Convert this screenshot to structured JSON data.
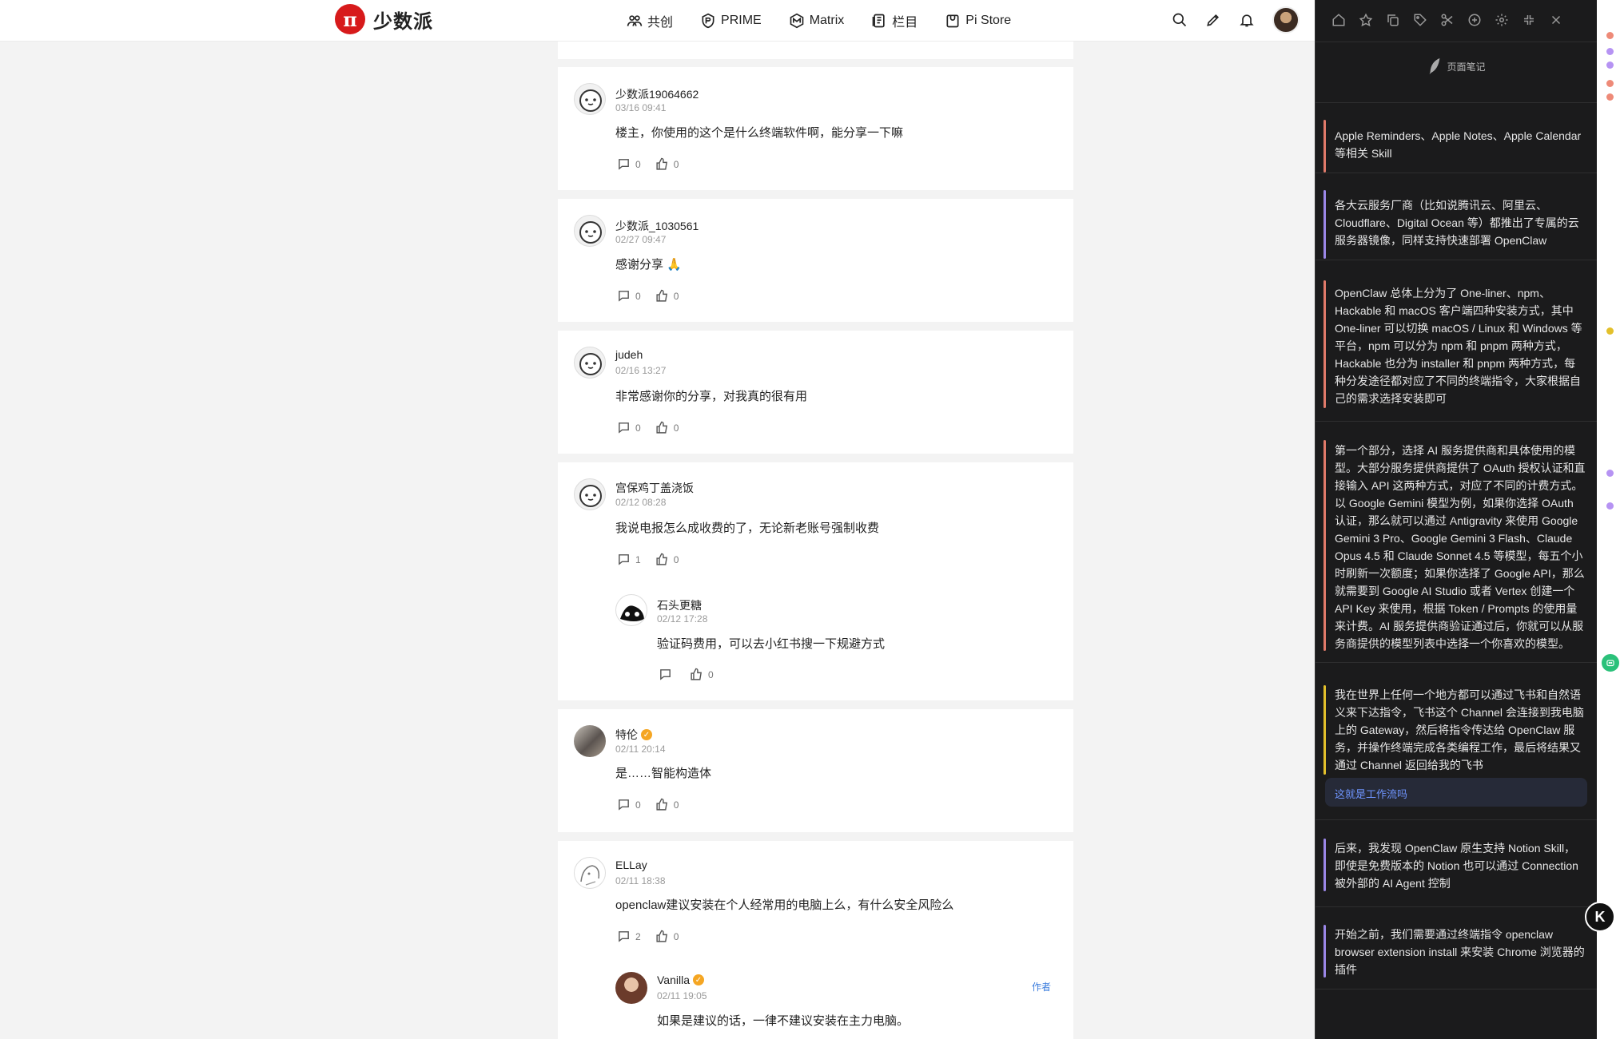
{
  "brand": {
    "logo_glyph": "π",
    "name": "少数派"
  },
  "nav": {
    "items": [
      {
        "label": "共创",
        "icon": "people-icon"
      },
      {
        "label": "PRIME",
        "icon": "prime-icon"
      },
      {
        "label": "Matrix",
        "icon": "matrix-icon"
      },
      {
        "label": "栏目",
        "icon": "columns-icon"
      },
      {
        "label": "Pi Store",
        "icon": "store-icon"
      }
    ],
    "right_icons": [
      "search-icon",
      "pen-icon",
      "bell-icon",
      "avatar"
    ]
  },
  "comments": [
    {
      "user": "少数派19064662",
      "date": "03/16 09:41",
      "text": "楼主，你使用的这个是什么终端软件啊，能分享一下嘛",
      "replies_count": "0",
      "likes": "0"
    },
    {
      "user": "少数派_1030561",
      "date": "02/27 09:47",
      "text": "感谢分享 🙏",
      "replies_count": "0",
      "likes": "0"
    },
    {
      "user": "judeh",
      "date": "02/16 13:27",
      "text": "非常感谢你的分享，对我真的很有用",
      "replies_count": "0",
      "likes": "0"
    },
    {
      "user": "宫保鸡丁盖浇饭",
      "date": "02/12 08:28",
      "text": "我说电报怎么成收费的了，无论新老账号强制收费",
      "replies_count": "1",
      "likes": "0",
      "reply": {
        "user": "石头更糖",
        "date": "02/12 17:28",
        "text": "验证码费用，可以去小红书搜一下规避方式",
        "likes": "0"
      }
    },
    {
      "user": "特伦",
      "date": "02/11 20:14",
      "text": "是……智能构造体",
      "replies_count": "0",
      "likes": "0",
      "verified": true
    },
    {
      "user": "ELLay",
      "date": "02/11 18:38",
      "text": "openclaw建议安装在个人经常用的电脑上么，有什么安全风险么",
      "replies_count": "2",
      "likes": "0",
      "reply": {
        "user": "Vanilla",
        "date": "02/11 19:05",
        "text": "如果是建议的话，一律不建议安装在主力电脑。",
        "badge": "作者",
        "verified": true
      }
    }
  ],
  "notes_panel": {
    "title": "页面笔记",
    "tools": [
      "home-icon",
      "star-icon",
      "copy-icon",
      "tag-icon",
      "scissors-icon",
      "plus-circle-icon",
      "settings-icon",
      "collapse-icon",
      "close-icon"
    ],
    "notes": [
      {
        "text": "Apple Reminders、Apple Notes、Apple Calendar 等相关 Skill",
        "color": "#e07a6a"
      },
      {
        "text": "各大云服务厂商（比如说腾讯云、阿里云、Cloudflare、Digital Ocean 等）都推出了专属的云服务器镜像，同样支持快速部署 OpenClaw",
        "color": "#9b87e8"
      },
      {
        "text": "OpenClaw 总体上分为了 One-liner、npm、Hackable 和 macOS 客户端四种安装方式，其中 One-liner 可以切换 macOS / Linux 和 Windows 等平台，npm 可以分为 npm 和 pnpm 两种方式，Hackable 也分为 installer 和 pnpm 两种方式，每种分发途径都对应了不同的终端指令，大家根据自己的需求选择安装即可",
        "color": "#e07a6a"
      },
      {
        "text": "第一个部分，选择 AI 服务提供商和具体使用的模型。大部分服务提供商提供了 OAuth 授权认证和直接输入 API 这两种方式，对应了不同的计费方式。以 Google Gemini 模型为例，如果你选择 OAuth 认证，那么就可以通过 Antigravity 来使用 Google Gemini 3 Pro、Google Gemini 3 Flash、Claude Opus 4.5 和 Claude Sonnet 4.5 等模型，每五个小时刷新一次额度；如果你选择了 Google API，那么就需要到 Google AI Studio 或者 Vertex 创建一个 API Key 来使用，根据 Token / Prompts 的使用量来计费。AI 服务提供商验证通过后，你就可以从服务商提供的模型列表中选择一个你喜欢的模型。",
        "color": "#e07a6a"
      },
      {
        "text": "我在世界上任何一个地方都可以通过飞书和自然语义来下达指令，飞书这个 Channel 会连接到我电脑上的 Gateway，然后将指令传达给 OpenClaw 服务，并操作终端完成各类编程工作，最后将结果又通过 Channel 返回给我的飞书",
        "color": "#e3c02b",
        "comment": "这就是工作流吗"
      },
      {
        "text": "后来，我发现 OpenClaw 原生支持 Notion Skill，即使是免费版本的 Notion 也可以通过 Connection 被外部的 AI Agent 控制",
        "color": "#9b87e8"
      },
      {
        "text": "开始之前，我们需要通过终端指令 openclaw browser extension install 来安装 Chrome 浏览器的插件",
        "color": "#9b87e8"
      }
    ]
  },
  "edge_colors": [
    "#ee8a78",
    "#b693f3",
    "#e3c02b"
  ],
  "float_badge": "K"
}
